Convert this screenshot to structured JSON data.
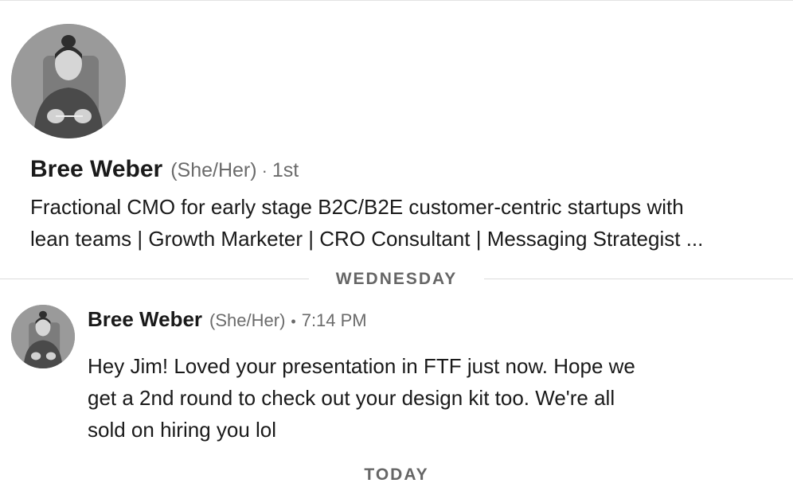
{
  "profile": {
    "name": "Bree Weber",
    "pronouns": "(She/Her)",
    "separator": "·",
    "connection_degree": "1st",
    "headline_line1": "Fractional CMO for early stage B2C/B2E customer-centric startups with",
    "headline_line2": "lean teams | Growth Marketer | CRO Consultant | Messaging Strategist ..."
  },
  "dividers": {
    "wednesday": "WEDNESDAY",
    "today": "TODAY"
  },
  "message": {
    "sender": "Bree Weber",
    "pronouns": "(She/Her)",
    "separator": "•",
    "time": "7:14 PM",
    "body_line1": "Hey Jim! Loved your presentation in FTF just now. Hope we",
    "body_line2": "get a 2nd round to check out your design kit too. We're all",
    "body_line3": "sold on hiring you lol"
  },
  "colors": {
    "text_primary": "#1a1a1a",
    "text_secondary": "#6b6b6b",
    "divider": "#dcdcdc",
    "background": "#ffffff"
  }
}
